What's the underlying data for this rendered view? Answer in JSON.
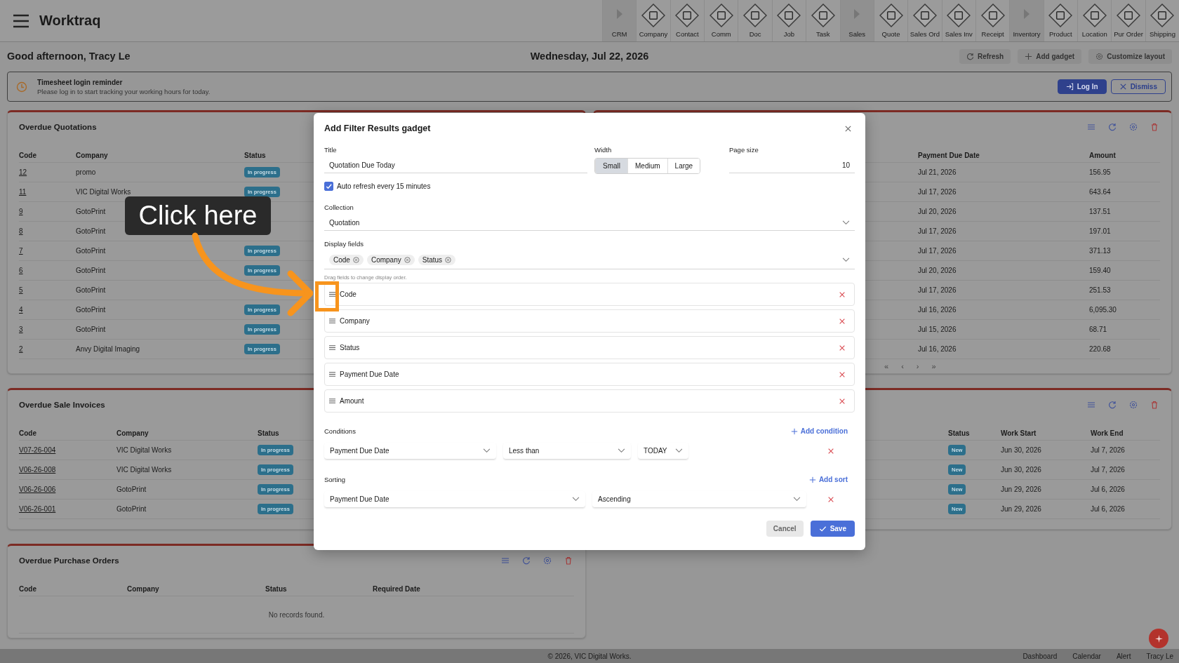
{
  "app": {
    "name": "Worktraq"
  },
  "nav": [
    {
      "label": "CRM",
      "kind": "group"
    },
    {
      "label": "Company",
      "kind": "module"
    },
    {
      "label": "Contact",
      "kind": "module"
    },
    {
      "label": "Comm",
      "kind": "module"
    },
    {
      "label": "Doc",
      "kind": "module"
    },
    {
      "label": "Job",
      "kind": "module"
    },
    {
      "label": "Task",
      "kind": "module"
    },
    {
      "label": "Sales",
      "kind": "group"
    },
    {
      "label": "Quote",
      "kind": "module"
    },
    {
      "label": "Sales Ord",
      "kind": "module"
    },
    {
      "label": "Sales Inv",
      "kind": "module"
    },
    {
      "label": "Receipt",
      "kind": "module"
    },
    {
      "label": "Inventory",
      "kind": "group"
    },
    {
      "label": "Product",
      "kind": "module"
    },
    {
      "label": "Location",
      "kind": "module"
    },
    {
      "label": "Pur Order",
      "kind": "module"
    },
    {
      "label": "Shipping",
      "kind": "module"
    }
  ],
  "greeting": "Good afternoon, Tracy Le",
  "date": "Wednesday, Jul 22, 2026",
  "actions": [
    {
      "label": "Refresh",
      "kind": "refresh"
    },
    {
      "label": "Add gadget",
      "kind": "add"
    },
    {
      "label": "Customize layout",
      "kind": "settings"
    }
  ],
  "reminder": {
    "title": "Timesheet login reminder",
    "text": "Please log in to start tracking your working hours for today.",
    "buttons": [
      {
        "label": "Log In",
        "kind": "primary"
      },
      {
        "label": "Dismiss",
        "kind": "outline"
      }
    ]
  },
  "left_panels": [
    {
      "title": "Overdue Quotations",
      "tools": false,
      "columns": [
        {
          "label": "Code",
          "kind": "link"
        },
        {
          "label": "Company",
          "kind": "text"
        },
        {
          "label": "Status",
          "kind": "badge"
        }
      ],
      "rows": [
        [
          "12",
          "promo",
          "In progress"
        ],
        [
          "11",
          "VIC Digital Works",
          "In progress"
        ],
        [
          "9",
          "GotoPrint"
        ],
        [
          "8",
          "GotoPrint"
        ],
        [
          "7",
          "GotoPrint",
          "In progress"
        ],
        [
          "6",
          "GotoPrint",
          "In progress"
        ],
        [
          "5",
          "GotoPrint"
        ],
        [
          "4",
          "GotoPrint",
          "In progress"
        ],
        [
          "3",
          "GotoPrint",
          "In progress"
        ],
        [
          "2",
          "Anvy Digital Imaging",
          "In progress"
        ]
      ]
    },
    {
      "title": "Overdue Sale Invoices",
      "tools": false,
      "columns": [
        {
          "label": "Code",
          "kind": "link"
        },
        {
          "label": "Company",
          "kind": "text"
        },
        {
          "label": "Status",
          "kind": "badge"
        }
      ],
      "rows": [
        [
          "V07-26-004",
          "VIC Digital Works",
          "In progress"
        ],
        [
          "V06-26-008",
          "VIC Digital Works",
          "In progress"
        ],
        [
          "V06-26-006",
          "GotoPrint",
          "In progress"
        ],
        [
          "V06-26-001",
          "GotoPrint",
          "In progress"
        ]
      ]
    },
    {
      "title": "Overdue Purchase Orders",
      "tools": true,
      "columns": [
        {
          "label": "Code"
        },
        {
          "label": "Company"
        },
        {
          "label": "Status"
        },
        {
          "label": "Required Date"
        }
      ],
      "empty_text": "No records found."
    }
  ],
  "right_panels": [
    {
      "columns": [
        {
          "label": "Payment Due Date",
          "kind": "text"
        },
        {
          "label": "Amount",
          "kind": "text"
        }
      ],
      "rows": [
        [
          "Jul 21, 2026",
          "156.95"
        ],
        [
          "Jul 17, 2026",
          "643.64"
        ],
        [
          "Jul 20, 2026",
          "137.51"
        ],
        [
          "Jul 17, 2026",
          "197.01"
        ],
        [
          "Jul 17, 2026",
          "371.13"
        ],
        [
          "Jul 20, 2026",
          "159.40"
        ],
        [
          "Jul 17, 2026",
          "251.53"
        ],
        [
          "Jul 16, 2026",
          "6,095.30"
        ],
        [
          "Jul 15, 2026",
          "68.71"
        ],
        [
          "Jul 16, 2026",
          "220.68"
        ]
      ],
      "pager": [
        "«",
        "‹",
        "›",
        "»"
      ]
    },
    {
      "columns": [
        {
          "label": "Status",
          "kind": "badge"
        },
        {
          "label": "Work Start",
          "kind": "text"
        },
        {
          "label": "Work End",
          "kind": "text"
        }
      ],
      "rows": [
        [
          "New",
          "Jun 30, 2026",
          "Jul 7, 2026"
        ],
        [
          "New",
          "Jun 30, 2026",
          "Jul 7, 2026"
        ],
        [
          "New",
          "Jun 29, 2026",
          "Jul 6, 2026"
        ],
        [
          "New",
          "Jun 29, 2026",
          "Jul 6, 2026"
        ]
      ]
    }
  ],
  "dialog": {
    "title": "Add Filter Results gadget",
    "title_label": "Title",
    "title_value": "Quotation Due Today",
    "width_label": "Width",
    "width_options": [
      {
        "label": "Small",
        "selected": true
      },
      {
        "label": "Medium",
        "selected": false
      },
      {
        "label": "Large",
        "selected": false
      }
    ],
    "page_size_label": "Page size",
    "page_size_value": "10",
    "auto_refresh": {
      "label": "Auto refresh every 15 minutes",
      "checked": true
    },
    "collection_label": "Collection",
    "collection_value": "Quotation",
    "display_label": "Display fields",
    "chips": [
      "Code",
      "Company",
      "Status"
    ],
    "hint": "Drag fields to change display order.",
    "order": [
      "Code",
      "Company",
      "Status",
      "Payment Due Date",
      "Amount"
    ],
    "conditions_label": "Conditions",
    "add_condition": "Add condition",
    "conditions": [
      {
        "field": "Payment Due Date",
        "operator": "Less than",
        "value": "TODAY"
      }
    ],
    "sorting_label": "Sorting",
    "add_sort": "Add sort",
    "sorts": [
      {
        "field": "Payment Due Date",
        "direction": "Ascending"
      }
    ],
    "cancel": "Cancel",
    "save": "Save"
  },
  "annotation": {
    "label": "Click here"
  },
  "footer": {
    "copyright": "© 2026, VIC Digital Works.",
    "links": [
      "Dashboard",
      "Calendar",
      "Alert",
      "Tracy Le"
    ]
  }
}
